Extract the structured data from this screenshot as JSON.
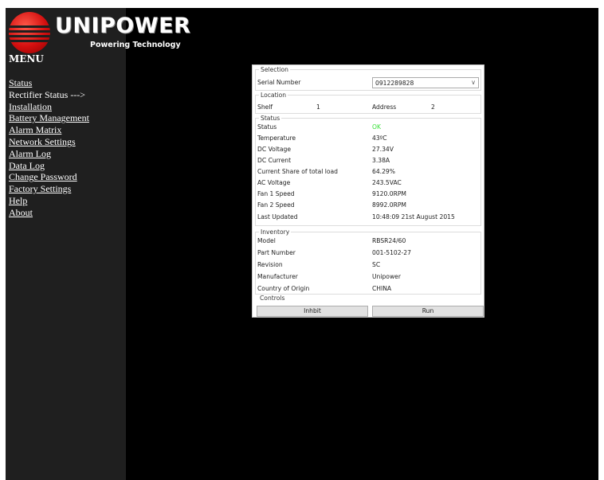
{
  "logo": {
    "wordmark": "UNIPOWER",
    "tagline": "Powering Technology"
  },
  "menu": {
    "heading": "MENU",
    "items": [
      "Status",
      "Rectifier Status --->",
      "Installation",
      "Battery Management",
      "Alarm Matrix",
      "Network Settings",
      "Alarm Log",
      "Data Log",
      "Change Password",
      "Factory Settings",
      "Help",
      "About"
    ]
  },
  "panel": {
    "selection": {
      "legend": "Selection",
      "serial_label": "Serial Number",
      "serial_value": "0912289828"
    },
    "location": {
      "legend": "Location",
      "shelf_label": "Shelf",
      "shelf_value": "1",
      "address_label": "Address",
      "address_value": "2"
    },
    "status": {
      "legend": "Status",
      "rows": [
        {
          "label": "Status",
          "value": "OK"
        },
        {
          "label": "Temperature",
          "value": "43ºC"
        },
        {
          "label": "DC Voltage",
          "value": "27.34V"
        },
        {
          "label": "DC Current",
          "value": "3.38A"
        },
        {
          "label": "Current Share of total load",
          "value": "64.29%"
        },
        {
          "label": "AC Voltage",
          "value": "243.5VAC"
        },
        {
          "label": "Fan 1 Speed",
          "value": "9120.0RPM"
        },
        {
          "label": "Fan 2 Speed",
          "value": "8992.0RPM"
        },
        {
          "label": "Last Updated",
          "value": "10:48:09 21st August 2015"
        }
      ]
    },
    "inventory": {
      "legend": "Inventory",
      "rows": [
        {
          "label": "Model",
          "value": "RBSR24/60"
        },
        {
          "label": "Part Number",
          "value": "001-5102-27"
        },
        {
          "label": "Revision",
          "value": "SC"
        },
        {
          "label": "Manufacturer",
          "value": "Unipower"
        },
        {
          "label": "Country of Origin",
          "value": "CHINA"
        }
      ]
    },
    "controls": {
      "legend": "Controls",
      "inhibit_label": "Inhbit",
      "run_label": "Run"
    }
  },
  "colors": {
    "background": "#000000",
    "sidebar": "#1f1f1f",
    "logo_red": "#d40f0f",
    "status_ok": "#38e038"
  }
}
